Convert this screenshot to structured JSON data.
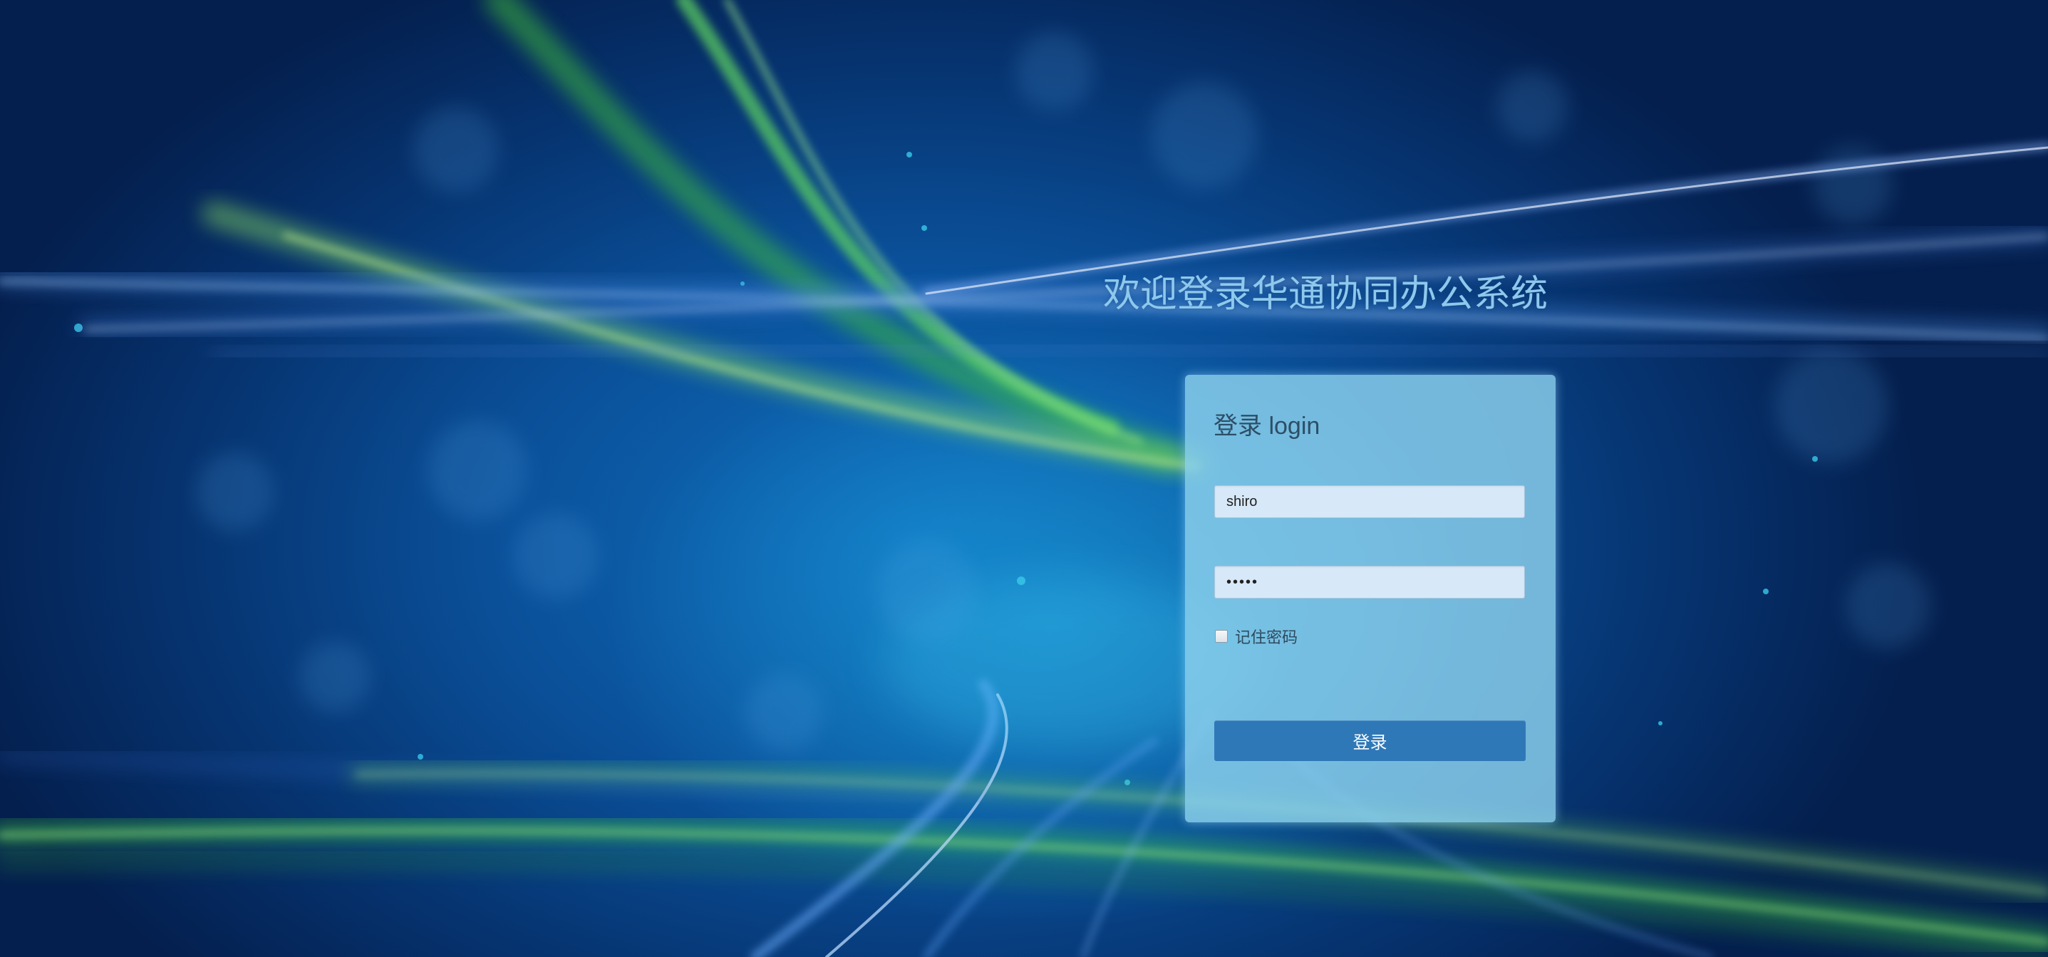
{
  "page": {
    "welcome_title": "欢迎登录华通协同办公系统"
  },
  "login_form": {
    "heading": "登录 login",
    "username_value": "shiro",
    "password_value": "•••••",
    "remember_label": "记住密码",
    "remember_checked": false,
    "submit_label": "登录"
  },
  "colors": {
    "background_deep": "#041f4e",
    "background_mid": "#0a4f98",
    "panel": "#8cd2ee",
    "title_text": "#8ec8ec",
    "button": "#2f78b8",
    "input_bg": "#d7e8f8",
    "light_streak_green": "#7ee06a",
    "light_streak_blue": "#7fb8ff"
  }
}
